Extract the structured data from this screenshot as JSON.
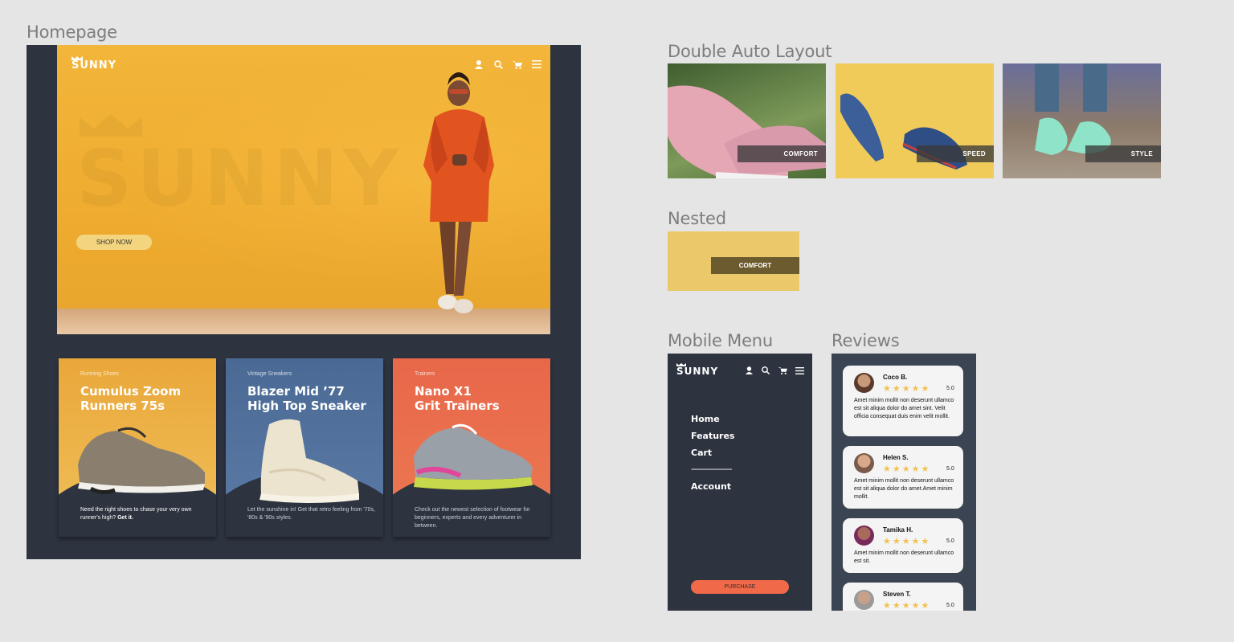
{
  "frames": {
    "homepage": "Homepage",
    "double_auto_layout": "Double Auto Layout",
    "nested": "Nested",
    "mobile_menu": "Mobile Menu",
    "reviews": "Reviews"
  },
  "brand": {
    "logo": "SUNNY",
    "ghost": "SUNNY"
  },
  "nav_icons": [
    "user-icon",
    "search-icon",
    "cart-icon",
    "menu-icon"
  ],
  "hero": {
    "cta": "SHOP NOW"
  },
  "cards": [
    {
      "category": "Running Shoes",
      "title": "Cumulus  Zoom\nRunners 75s",
      "desc": "Need the right shoes to chase your very own runner's high?",
      "desc_bold": "Get it.",
      "color": "#e9a73a"
    },
    {
      "category": "Vintage Sneakers",
      "title": "Blazer Mid  ’77\nHigh Top Sneaker",
      "desc": "Let the sunshine in! Get that retro feeling from '70s, '80s & '90s styles.",
      "desc_bold": "",
      "color": "#4a6a95"
    },
    {
      "category": "Trainers",
      "title": "Nano X1\nGrit Trainers",
      "desc": "Check out the newest selection of footwear for beginners, experts and every adventurer in between.",
      "desc_bold": "",
      "color": "#e86a4a"
    }
  ],
  "tiles": [
    {
      "tag": "COMFORT"
    },
    {
      "tag": "SPEED"
    },
    {
      "tag": "STYLE"
    }
  ],
  "nested": {
    "tag": "COMFORT"
  },
  "mobile": {
    "logo": "SUNNY",
    "menu": [
      "Home",
      "Features",
      "Cart",
      "-----------------",
      "Account"
    ],
    "purchase": "PURCHASE"
  },
  "reviews": [
    {
      "name": "Coco B.",
      "stars": "★★★★★",
      "score": "5.0",
      "text": "Amet minim mollit non deserunt ullamco est sit aliqua dolor do amet sint. Velit officia consequat duis enim velit mollit."
    },
    {
      "name": "Helen S.",
      "stars": "★★★★★",
      "score": "5.0",
      "text": "Amet minim mollit non deserunt ullamco est sit aliqua dolor do amet.Amet minim mollit."
    },
    {
      "name": "Tamika H.",
      "stars": "★★★★★",
      "score": "5.0",
      "text": "Amet minim mollit non deserunt ullamco est sit."
    },
    {
      "name": "Steven T.",
      "stars": "★★★★★",
      "score": "5.0",
      "text": ""
    }
  ]
}
